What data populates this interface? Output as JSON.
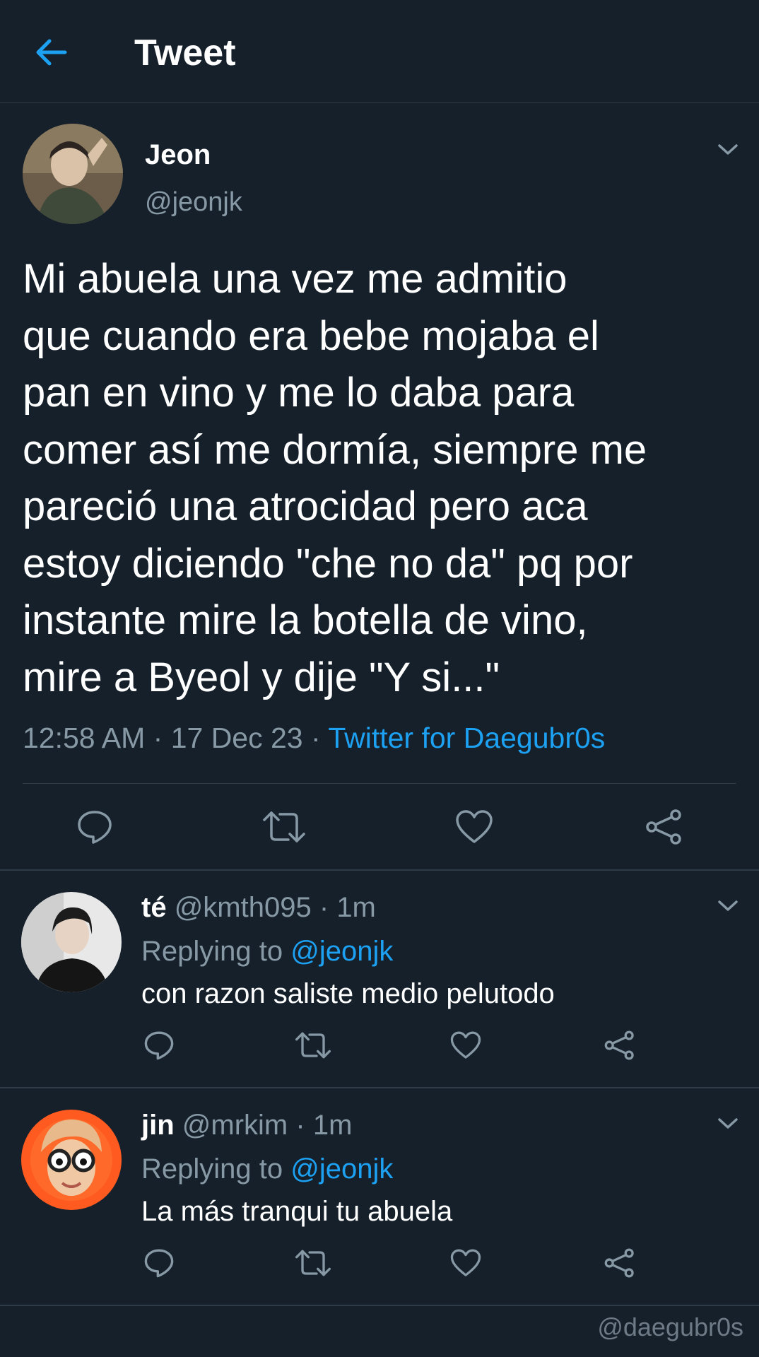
{
  "header": {
    "back_icon": "arrow-left-icon",
    "title": "Tweet",
    "accent_color": "#1da1f2"
  },
  "main_tweet": {
    "name": "Jeon",
    "handle": "@jeonjk",
    "text_lines": [
      "Mi abuela una vez me admitio",
      "que cuando era bebe mojaba el",
      "pan en vino y me lo daba para",
      "comer así me dormía, siempre me",
      "pareció una atrocidad pero aca",
      "estoy diciendo \"che no da\" pq por",
      "instante mire la botella de vino,",
      "mire a Byeol y dije \"Y si...\""
    ],
    "time": "12:58 AM",
    "date": "17 Dec 23",
    "separator": "·",
    "source": "Twitter for Daegubr0s"
  },
  "replies": [
    {
      "name": "té",
      "handle": "@kmth095",
      "time": "1m",
      "replying_prefix": "Replying to",
      "replying_to": "@jeonjk",
      "text": "con razon saliste medio pelutodo"
    },
    {
      "name": "jin",
      "handle": "@mrkim",
      "time": "1m",
      "replying_prefix": "Replying to",
      "replying_to": "@jeonjk",
      "text": "La más tranqui tu abuela"
    }
  ],
  "watermark": "@daegubr0s",
  "colors": {
    "background": "#15202b",
    "divider": "#2f3b47",
    "secondary_text": "#8899a6",
    "link": "#1da1f2"
  }
}
